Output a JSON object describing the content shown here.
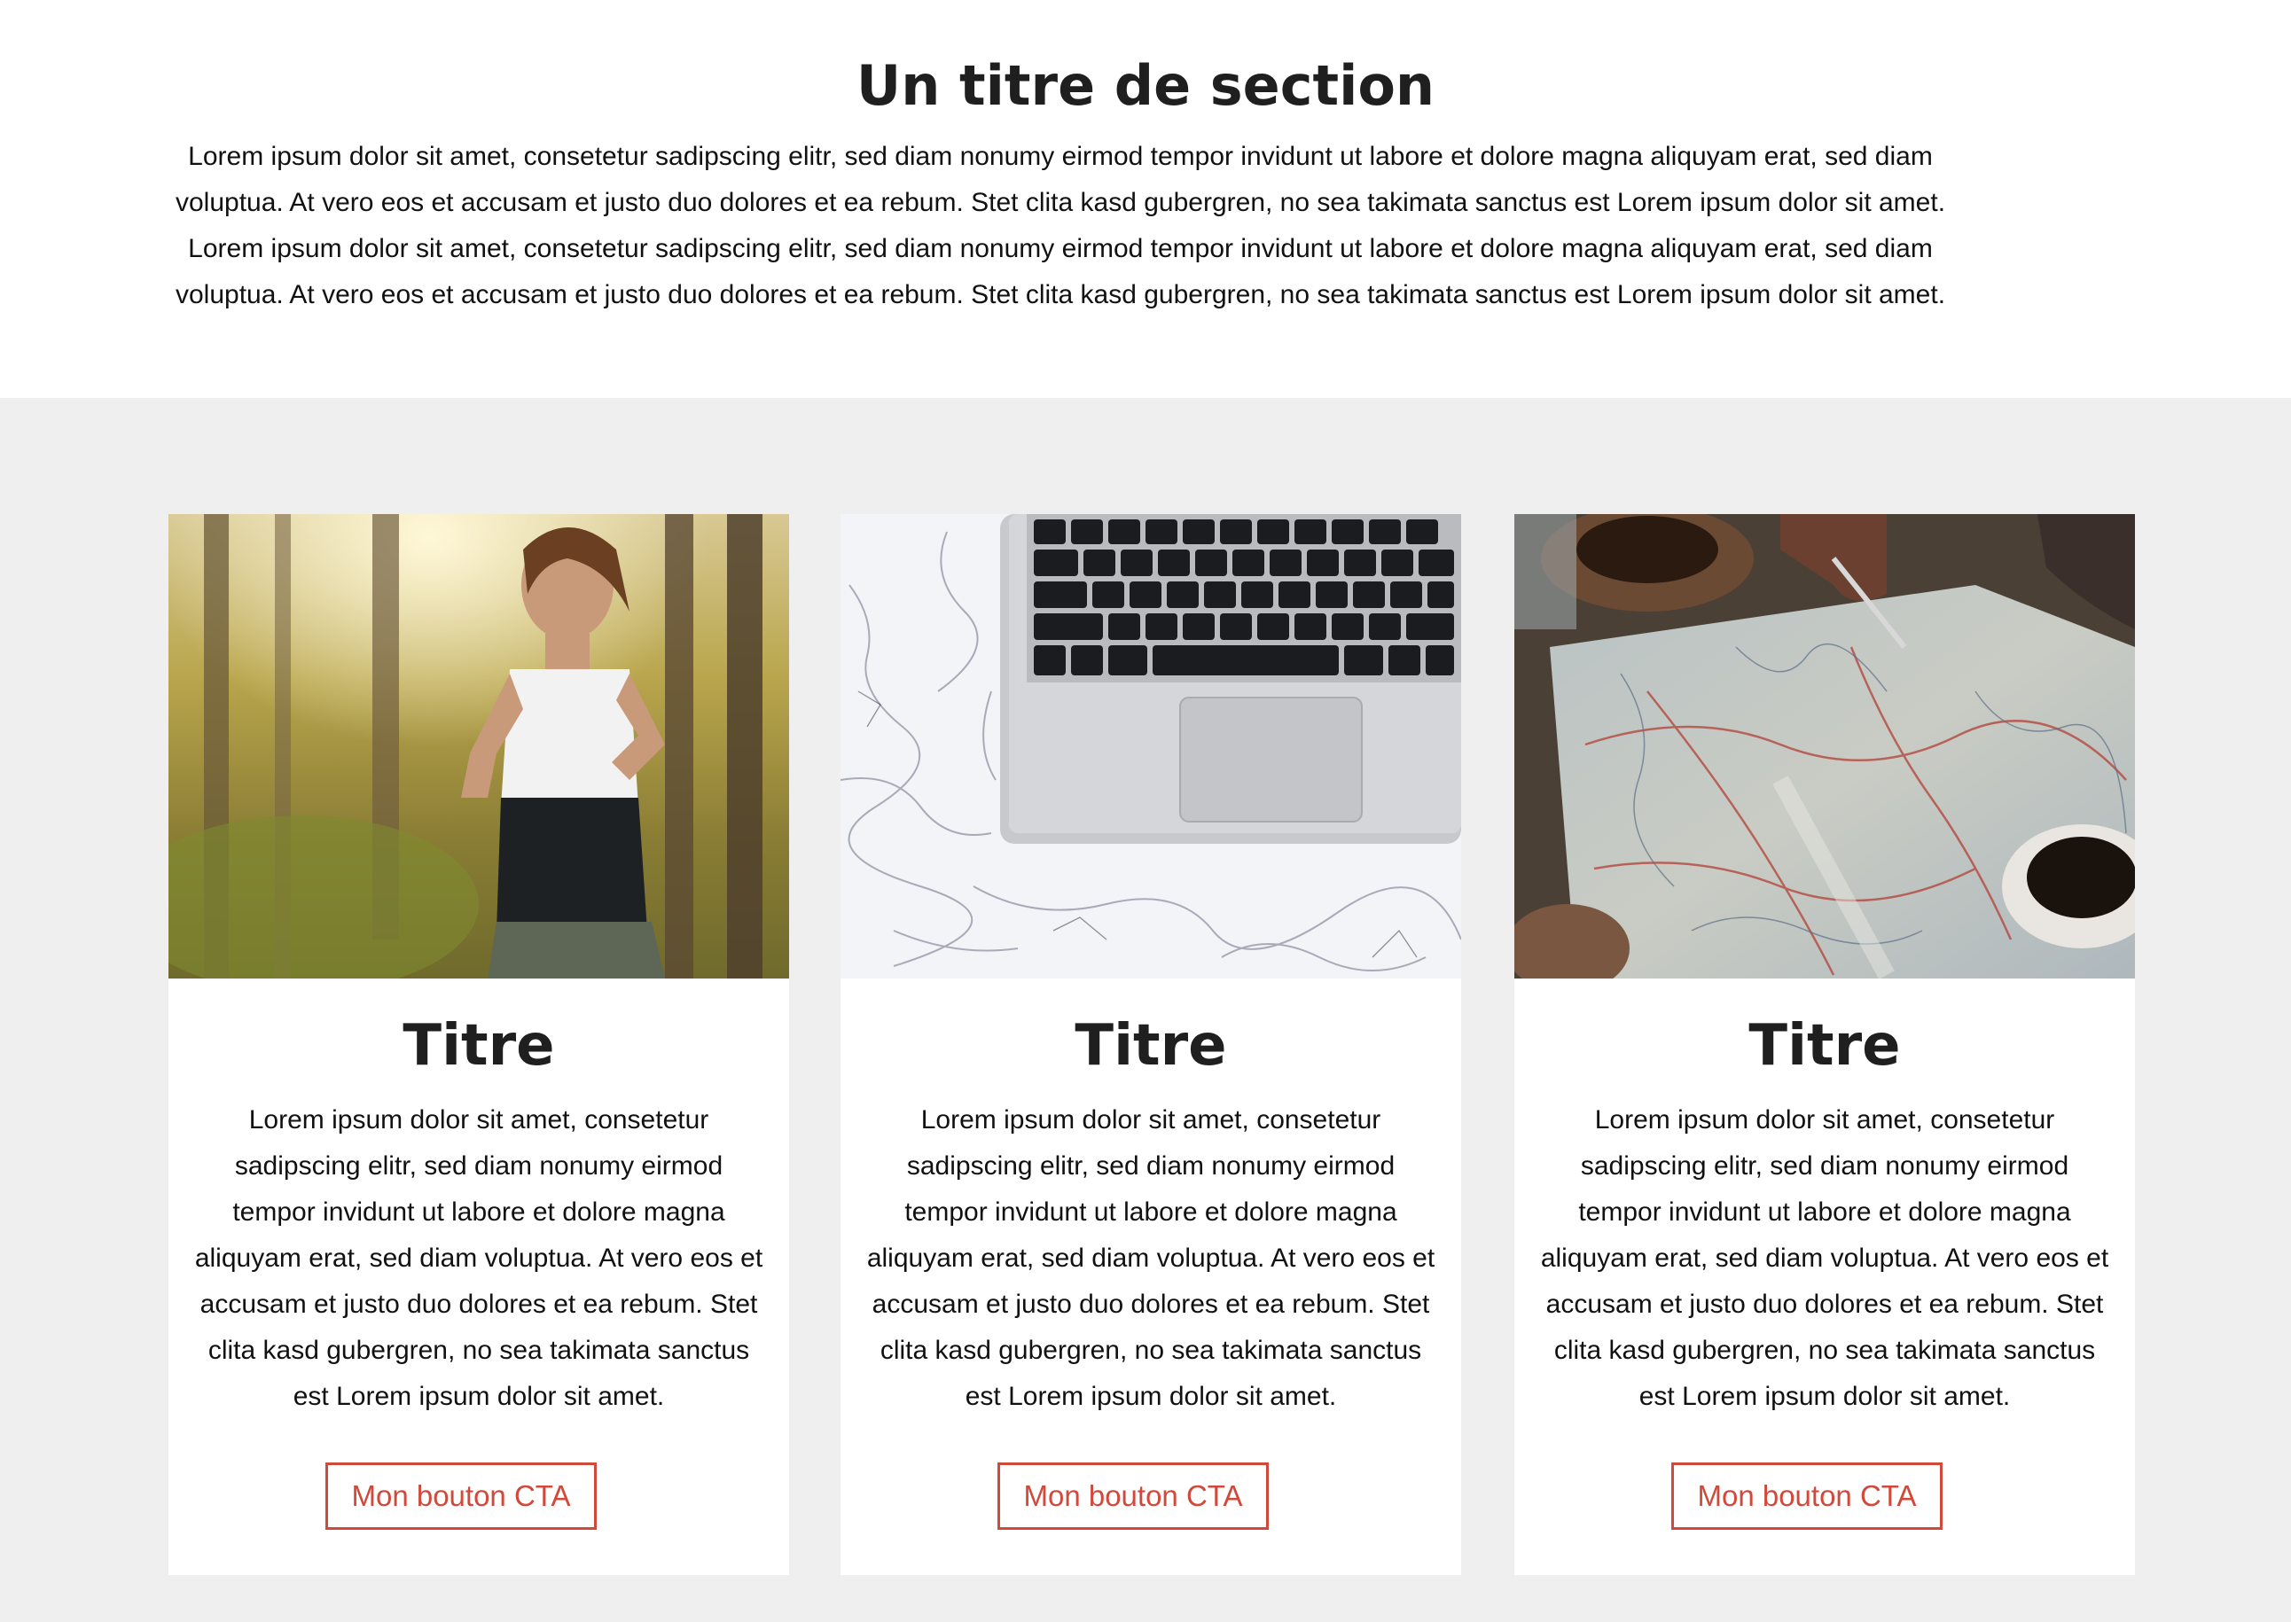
{
  "section": {
    "title": "Un titre de section",
    "text": "Lorem ipsum dolor sit amet, consetetur sadipscing elitr, sed diam nonumy eirmod tempor invidunt ut labore et dolore magna aliquyam erat, sed diam voluptua. At vero eos et accusam et justo duo dolores et ea rebum. Stet clita kasd gubergren, no sea takimata sanctus est Lorem ipsum dolor sit amet. Lorem ipsum dolor sit amet, consetetur sadipscing elitr, sed diam nonumy eirmod tempor invidunt ut labore et dolore magna aliquyam erat, sed diam voluptua. At vero eos et accusam et justo duo dolores et ea rebum. Stet clita kasd gubergren, no sea takimata sanctus est Lorem ipsum dolor sit amet."
  },
  "cards": [
    {
      "image": "woman-running-photo",
      "title": "Titre",
      "text": "Lorem ipsum dolor sit amet, consetetur sadipscing elitr, sed diam nonumy eirmod tempor invidunt ut labore et dolore magna aliquyam erat, sed diam voluptua. At vero eos et accusam et justo duo dolores et ea rebum. Stet clita kasd gubergren, no sea takimata sanctus est Lorem ipsum dolor sit amet.",
      "cta_label": "Mon bouton CTA"
    },
    {
      "image": "laptop-on-marble-photo",
      "title": "Titre",
      "text": "Lorem ipsum dolor sit amet, consetetur sadipscing elitr, sed diam nonumy eirmod tempor invidunt ut labore et dolore magna aliquyam erat, sed diam voluptua. At vero eos et accusam et justo duo dolores et ea rebum. Stet clita kasd gubergren, no sea takimata sanctus est Lorem ipsum dolor sit amet.",
      "cta_label": "Mon bouton CTA"
    },
    {
      "image": "map-and-coffee-photo",
      "title": "Titre",
      "text": "Lorem ipsum dolor sit amet, consetetur sadipscing elitr, sed diam nonumy eirmod tempor invidunt ut labore et dolore magna aliquyam erat, sed diam voluptua. At vero eos et accusam et justo duo dolores et ea rebum. Stet clita kasd gubergren, no sea takimata sanctus est Lorem ipsum dolor sit amet.",
      "cta_label": "Mon bouton CTA"
    }
  ],
  "colors": {
    "accent": "#d0493a",
    "background_grey": "#efefef",
    "card_background": "#ffffff",
    "text": "#111111"
  }
}
